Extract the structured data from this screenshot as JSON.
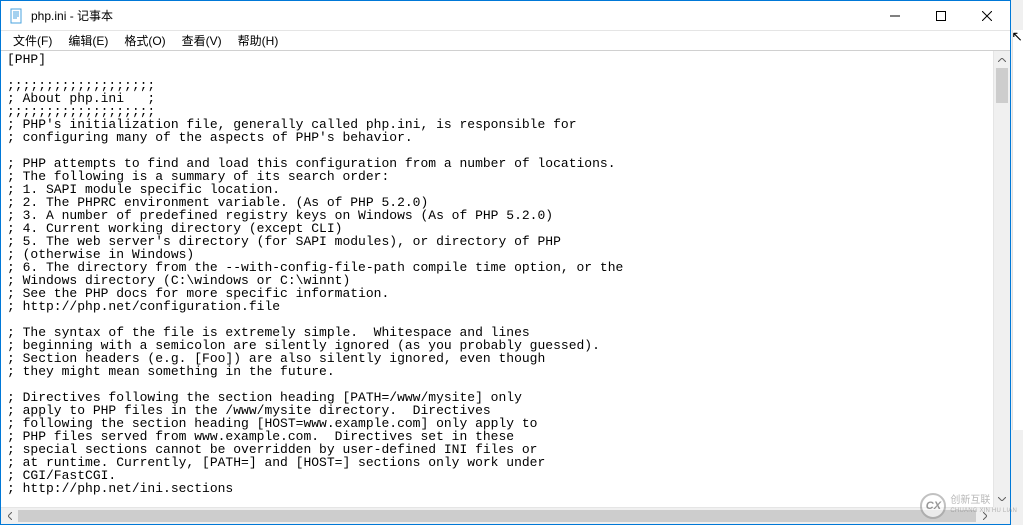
{
  "window": {
    "title": "php.ini - 记事本"
  },
  "menu": {
    "file": "文件(F)",
    "edit": "编辑(E)",
    "format": "格式(O)",
    "view": "查看(V)",
    "help": "帮助(H)"
  },
  "content": "[PHP]\n\n;;;;;;;;;;;;;;;;;;;\n; About php.ini   ;\n;;;;;;;;;;;;;;;;;;;\n; PHP's initialization file, generally called php.ini, is responsible for\n; configuring many of the aspects of PHP's behavior.\n\n; PHP attempts to find and load this configuration from a number of locations.\n; The following is a summary of its search order:\n; 1. SAPI module specific location.\n; 2. The PHPRC environment variable. (As of PHP 5.2.0)\n; 3. A number of predefined registry keys on Windows (As of PHP 5.2.0)\n; 4. Current working directory (except CLI)\n; 5. The web server's directory (for SAPI modules), or directory of PHP\n; (otherwise in Windows)\n; 6. The directory from the --with-config-file-path compile time option, or the\n; Windows directory (C:\\windows or C:\\winnt)\n; See the PHP docs for more specific information.\n; http://php.net/configuration.file\n\n; The syntax of the file is extremely simple.  Whitespace and lines\n; beginning with a semicolon are silently ignored (as you probably guessed).\n; Section headers (e.g. [Foo]) are also silently ignored, even though\n; they might mean something in the future.\n\n; Directives following the section heading [PATH=/www/mysite] only\n; apply to PHP files in the /www/mysite directory.  Directives\n; following the section heading [HOST=www.example.com] only apply to\n; PHP files served from www.example.com.  Directives set in these\n; special sections cannot be overridden by user-defined INI files or\n; at runtime. Currently, [PATH=] and [HOST=] sections only work under\n; CGI/FastCGI.\n; http://php.net/ini.sections",
  "watermark": {
    "badge": "CX",
    "line1": "创新互联",
    "line2": "CHUANG XIN HU LIAN"
  }
}
